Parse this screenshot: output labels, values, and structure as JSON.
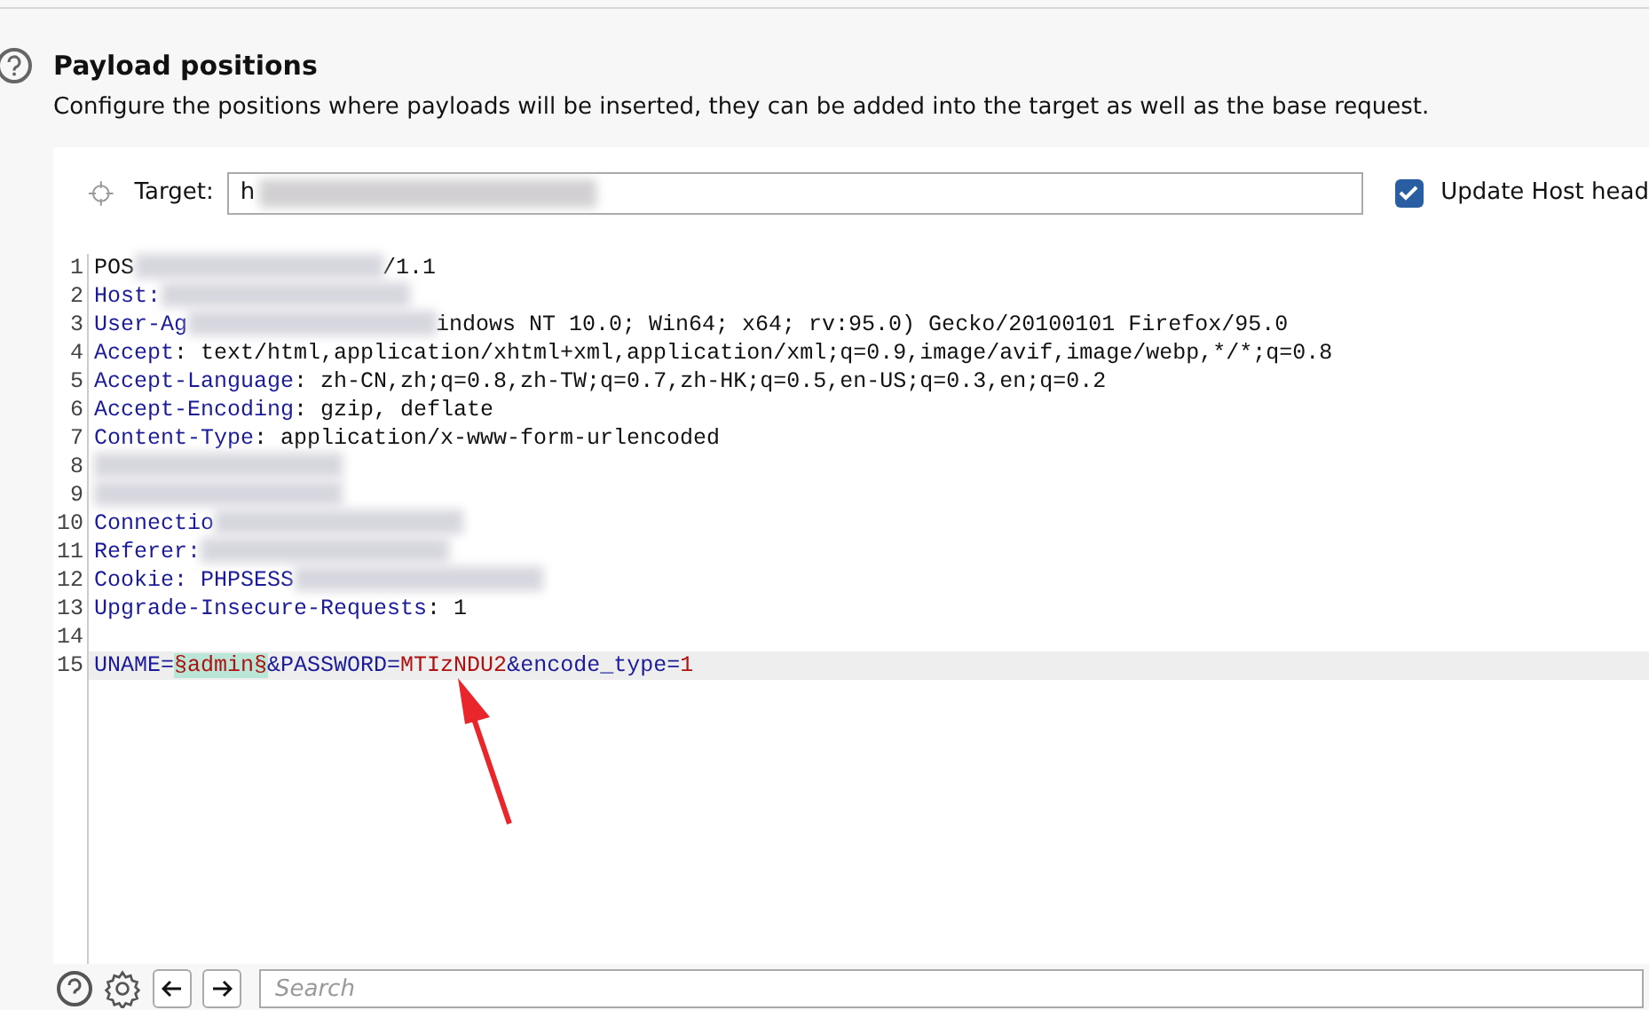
{
  "section": {
    "title": "Payload positions",
    "description": "Configure the positions where payloads will be inserted, they can be added into the target as well as the base request."
  },
  "target": {
    "label": "Target:",
    "value": "h"
  },
  "update_host": {
    "label": "Update Host head",
    "checked": true
  },
  "editor": {
    "lines": [
      {
        "number": "1",
        "segments": [
          {
            "kind": "plain",
            "text": "POS"
          },
          {
            "kind": "redacted"
          },
          {
            "kind": "plain",
            "text": "/1.1"
          }
        ]
      },
      {
        "number": "2",
        "segments": [
          {
            "kind": "key",
            "text": "Host:"
          },
          {
            "kind": "redacted"
          }
        ]
      },
      {
        "number": "3",
        "segments": [
          {
            "kind": "key",
            "text": "User-Ag"
          },
          {
            "kind": "redacted"
          },
          {
            "kind": "plain",
            "text": "indows NT 10.0; Win64; x64; rv:95.0) Gecko/20100101 Firefox/95.0"
          }
        ]
      },
      {
        "number": "4",
        "segments": [
          {
            "kind": "key",
            "text": "Accept"
          },
          {
            "kind": "plain",
            "text": ": text/html,application/xhtml+xml,application/xml;q=0.9,image/avif,image/webp,*/*;q=0.8"
          }
        ]
      },
      {
        "number": "5",
        "segments": [
          {
            "kind": "key",
            "text": "Accept-Language"
          },
          {
            "kind": "plain",
            "text": ": zh-CN,zh;q=0.8,zh-TW;q=0.7,zh-HK;q=0.5,en-US;q=0.3,en;q=0.2"
          }
        ]
      },
      {
        "number": "6",
        "segments": [
          {
            "kind": "key",
            "text": "Accept-Encoding"
          },
          {
            "kind": "plain",
            "text": ": gzip, deflate"
          }
        ]
      },
      {
        "number": "7",
        "segments": [
          {
            "kind": "key",
            "text": "Content-Type"
          },
          {
            "kind": "plain",
            "text": ": application/x-www-form-urlencoded"
          }
        ]
      },
      {
        "number": "8",
        "segments": [
          {
            "kind": "redacted"
          }
        ]
      },
      {
        "number": "9",
        "segments": [
          {
            "kind": "redacted"
          }
        ]
      },
      {
        "number": "10",
        "segments": [
          {
            "kind": "key",
            "text": "Connectio"
          },
          {
            "kind": "redacted"
          }
        ]
      },
      {
        "number": "11",
        "segments": [
          {
            "kind": "key",
            "text": "Referer:"
          },
          {
            "kind": "redacted"
          }
        ]
      },
      {
        "number": "12",
        "segments": [
          {
            "kind": "key",
            "text": "Cookie:"
          },
          {
            "kind": "key",
            "text": " PHPSESS"
          },
          {
            "kind": "redacted"
          }
        ]
      },
      {
        "number": "13",
        "segments": [
          {
            "kind": "key",
            "text": "Upgrade-Insecure-Requests"
          },
          {
            "kind": "plain",
            "text": ": 1"
          }
        ]
      },
      {
        "number": "14"
      },
      {
        "number": "15",
        "current": true,
        "segments": [
          {
            "kind": "key",
            "text": "UNAME="
          },
          {
            "kind": "payload",
            "text": "§admin§"
          },
          {
            "kind": "key",
            "text": "&PASSWORD="
          },
          {
            "kind": "value",
            "text": "MTIzNDU2"
          },
          {
            "kind": "key",
            "text": "&encode_type="
          },
          {
            "kind": "value",
            "text": "1"
          }
        ]
      }
    ]
  },
  "search": {
    "placeholder": "Search"
  }
}
